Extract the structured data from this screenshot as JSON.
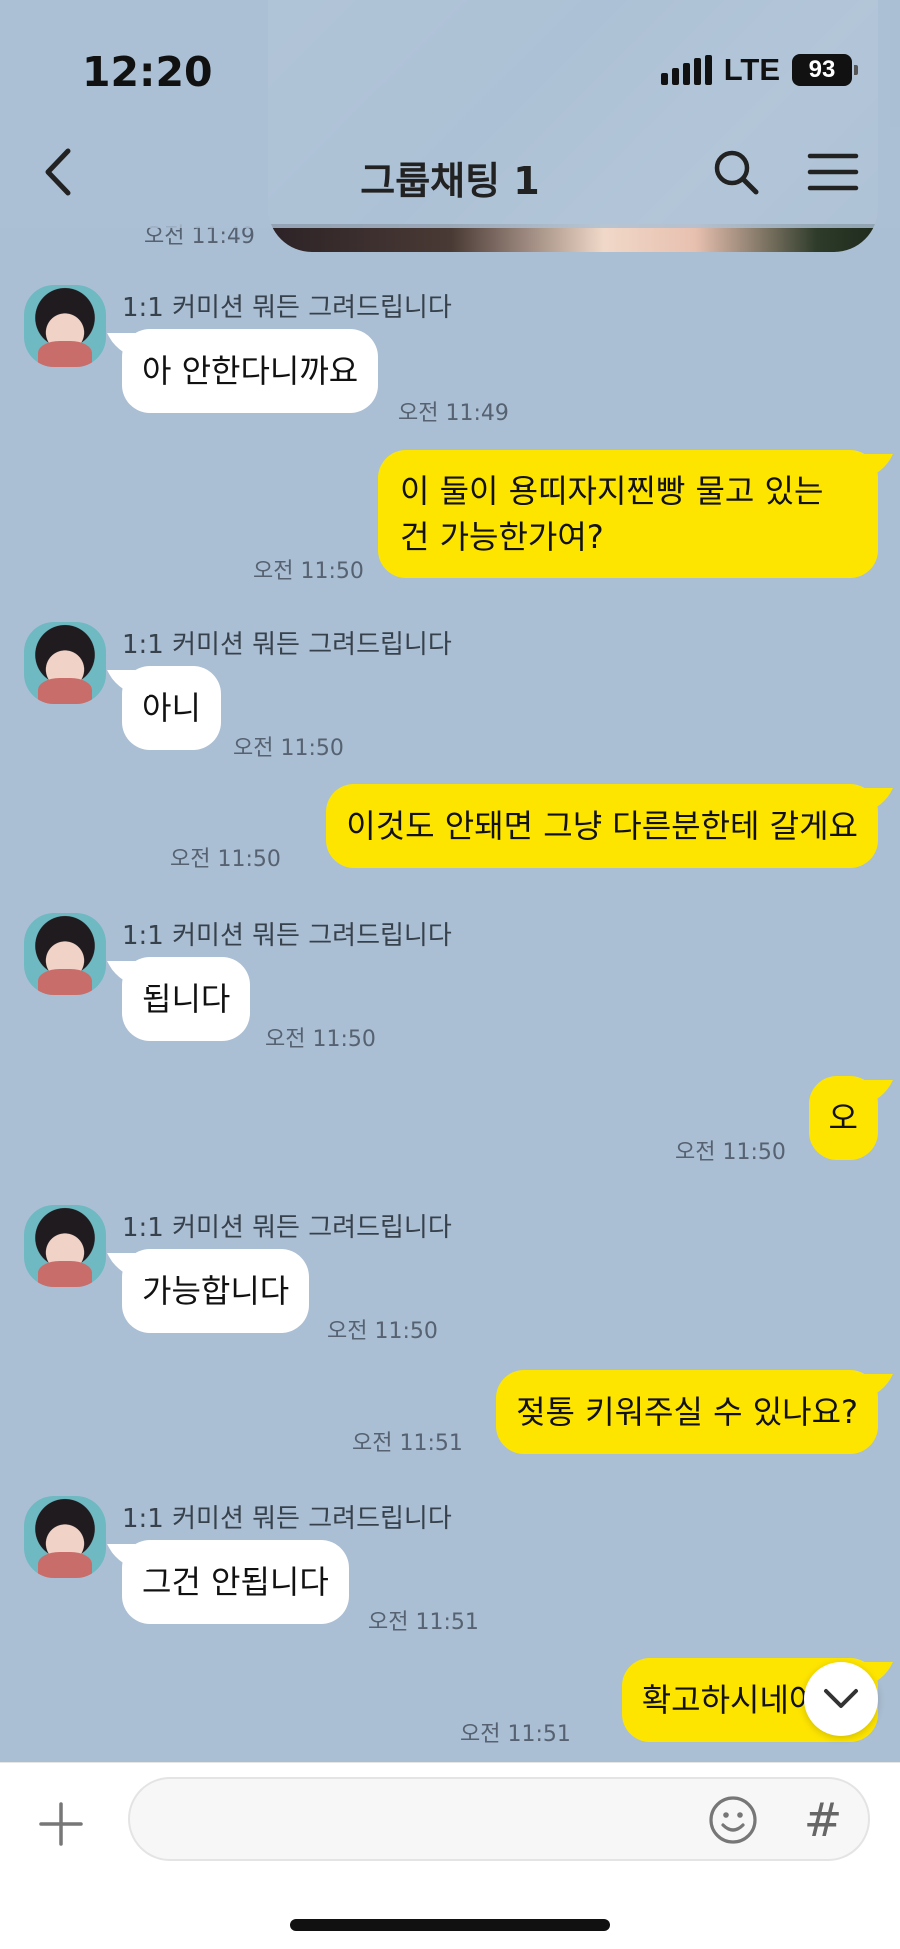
{
  "status": {
    "time": "12:20",
    "network": "LTE",
    "battery": "93"
  },
  "header": {
    "title": "그룹채팅 1",
    "back_icon": "chevron-left-icon",
    "search_icon": "search-icon",
    "menu_icon": "hamburger-menu-icon"
  },
  "cutoff_time": "오전 11:49",
  "messages": [
    {
      "dir": "in",
      "sender": "1:1 커미션 뭐든 그려드립니다",
      "text": "아 안한다니까요",
      "time": "오전 11:49"
    },
    {
      "dir": "out",
      "text": "이 둘이 용띠자지찐빵 물고 있는 건 가능한가여?",
      "time": "오전 11:50"
    },
    {
      "dir": "in",
      "sender": "1:1 커미션 뭐든 그려드립니다",
      "text": "아니",
      "time": "오전 11:50"
    },
    {
      "dir": "out",
      "text": "이것도 안돼면 그냥 다른분한테 갈게요",
      "time": "오전 11:50"
    },
    {
      "dir": "in",
      "sender": "1:1 커미션 뭐든 그려드립니다",
      "text": "됩니다",
      "time": "오전 11:50"
    },
    {
      "dir": "out",
      "text": "오",
      "time": "오전 11:50"
    },
    {
      "dir": "in",
      "sender": "1:1 커미션 뭐든 그려드립니다",
      "text": "가능합니다",
      "time": "오전 11:50"
    },
    {
      "dir": "out",
      "text": "젖통 키워주실 수 있나요?",
      "time": "오전 11:51"
    },
    {
      "dir": "in",
      "sender": "1:1 커미션 뭐든 그려드립니다",
      "text": "그건 안됩니다",
      "time": "오전 11:51"
    },
    {
      "dir": "out",
      "text": "확고하시네여 ㅎ",
      "time": "오전 11:51"
    }
  ],
  "input": {
    "placeholder": "",
    "value": "",
    "attach_icon": "plus-icon",
    "emoji_icon": "emoji-icon",
    "hashtag": "#"
  },
  "colors": {
    "background": "#abbfd4",
    "outgoing_bubble": "#fee500",
    "incoming_bubble": "#ffffff"
  }
}
